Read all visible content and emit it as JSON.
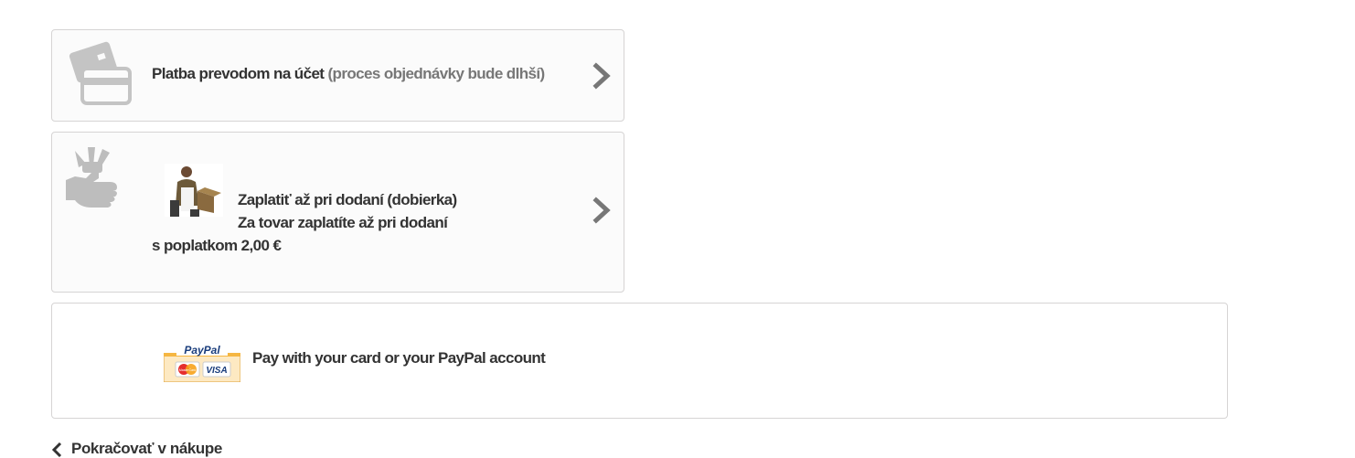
{
  "payment_options": {
    "bank_transfer": {
      "icon": "credit-card-icon",
      "label": "Platba prevodom na účet",
      "note": "(proces objednávky bude dlhší)"
    },
    "cash_on_delivery": {
      "icon": "hand-money-icon",
      "line1": "Zaplatiť až pri dodaní (dobierka)",
      "line2": "Za tovar zaplatíte až pri dodaní",
      "line3": "s poplatkom 2,00 €"
    },
    "paypal": {
      "logo_text": "PayPal",
      "logo_cards": [
        "MasterCard",
        "VISA"
      ],
      "label": "Pay with your card or your PayPal account"
    }
  },
  "continue_shopping": "Pokračovať v nákupe",
  "colors": {
    "border": "#d6d4d4",
    "panel_bg": "#fbfbfb",
    "icon_gray": "#bdbdbd",
    "text": "#333333",
    "muted_text": "#777777"
  }
}
